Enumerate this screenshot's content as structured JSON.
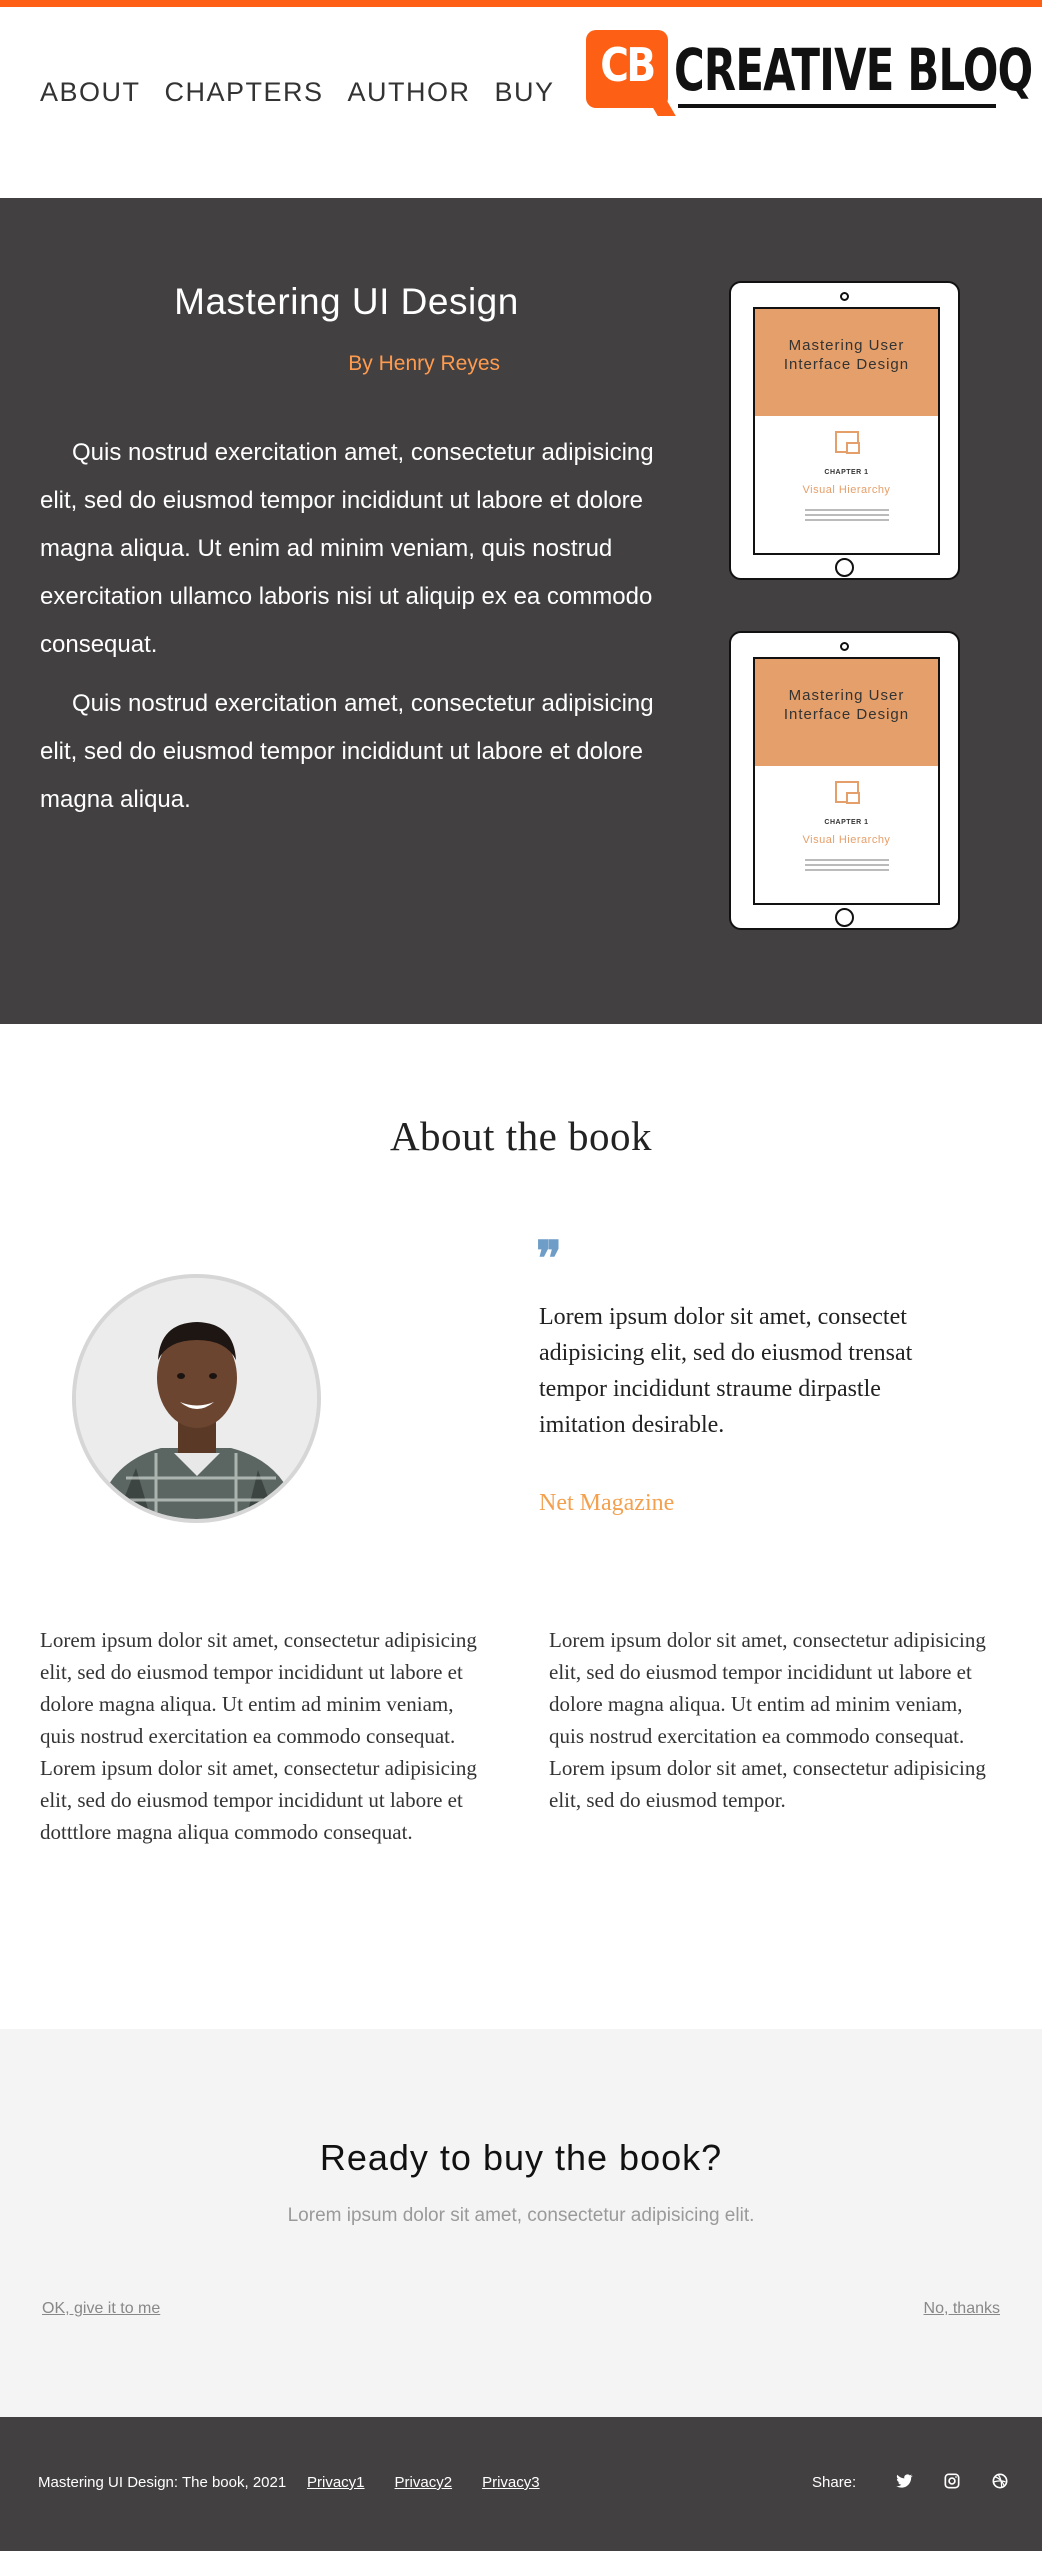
{
  "nav": {
    "items": [
      "ABOUT",
      "CHAPTERS",
      "AUTHOR",
      "BUY"
    ]
  },
  "logo": {
    "badge": "CB",
    "wordmark": "CREATIVE BLOQ",
    "accent": "#fd5f14"
  },
  "hero": {
    "title": "Mastering UI Design",
    "author": "By Henry Reyes",
    "paragraphs": [
      "Quis nostrud exercitation amet, consectetur adipisicing elit, sed do eiusmod tempor incididunt ut labore et dolore magna aliqua. Ut enim ad minim veniam, quis nostrud exercitation ullamco laboris nisi ut aliquip ex ea commodo consequat.",
      "Quis nostrud exercitation amet, consectetur adipisicing elit, sed do eiusmod tempor incididunt ut labore et dolore magna aliqua."
    ],
    "background": "#424041",
    "accent": "#ff9b4f"
  },
  "tablet": {
    "cover_title": "Mastering User Interface Design",
    "chapter_label": "CHAPTER 1",
    "chapter_title": "Visual Hierarchy"
  },
  "about": {
    "title": "About the book",
    "quote_mark": "❞",
    "quote": "Lorem ipsum dolor sit amet, consectet adipisicing elit, sed do eiusmod trensat tempor incididunt straume dirpastle imitation desirable.",
    "quote_source": "Net Magazine",
    "left_column": [
      "Lorem ipsum dolor sit amet, consectetur adipisicing elit, sed do eiusmod tempor incididunt ut labore et dolore magna aliqua. Ut entim ad minim veniam, quis nostrud exercitation ea commodo consequat.",
      "Lorem ipsum dolor sit amet, consectetur adipisicing elit, sed do eiusmod tempor incididunt ut labore et dotttlore magna aliqua commodo consequat."
    ],
    "right_column": [
      "Lorem ipsum dolor sit amet, consectetur adipisicing elit, sed do eiusmod tempor incididunt ut labore et dolore magna aliqua. Ut entim ad minim veniam, quis nostrud exercitation ea commodo consequat.",
      "Lorem ipsum dolor sit amet, consectetur adipisicing elit, sed do eiusmod tempor."
    ]
  },
  "cta": {
    "title": "Ready to buy the book?",
    "subtitle": "Lorem ipsum dolor sit amet, consectetur adipisicing elit.",
    "accept": "OK, give it to me",
    "decline": "No, thanks"
  },
  "footer": {
    "copyright": "Mastering UI Design: The book, 2021",
    "links": [
      "Privacy1",
      "Privacy2",
      "Privacy3"
    ],
    "share_label": "Share:",
    "social_icons": [
      "twitter-icon",
      "instagram-icon",
      "dribbble-icon"
    ]
  }
}
